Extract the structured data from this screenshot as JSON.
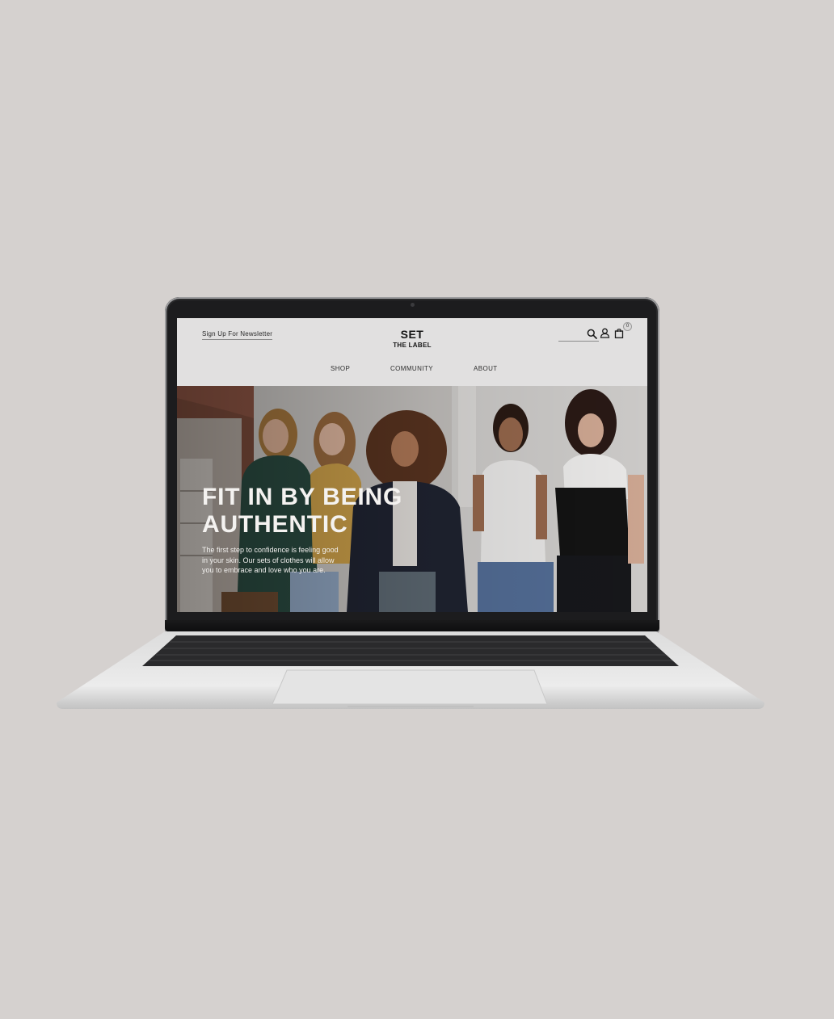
{
  "header": {
    "newsletter_label": "Sign Up For Newsletter",
    "logo_main": "SET",
    "logo_sub": "THE LABEL",
    "cart_count": "0",
    "icons": [
      "search-icon",
      "account-icon",
      "shopping-bag-icon"
    ]
  },
  "nav": {
    "items": [
      "SHOP",
      "COMMUNITY",
      "ABOUT"
    ]
  },
  "hero": {
    "heading": "FIT IN BY BEING AUTHENTIC",
    "body": "The first step to confidence is feeling good in your skin. Our sets of clothes will allow you to embrace and love who you are."
  },
  "colors": {
    "background": "#d5d1cf",
    "header_bg": "#e1e0e0",
    "text_dark": "#141414",
    "hero_text": "#f4f2f0"
  }
}
